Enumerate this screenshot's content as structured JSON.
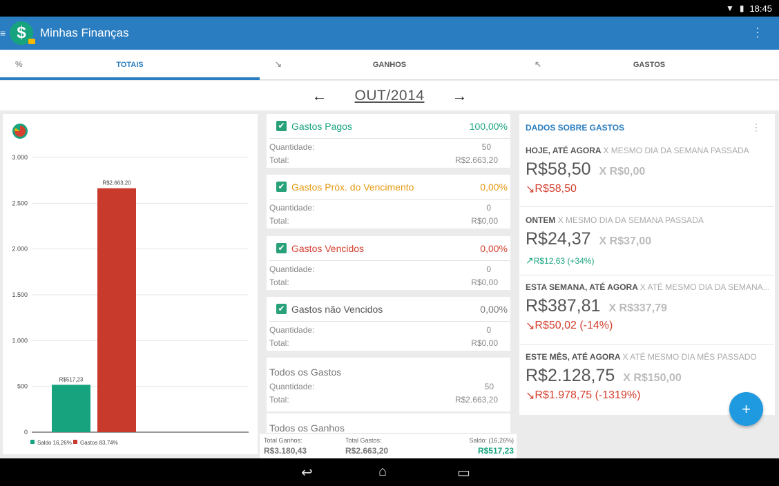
{
  "status": {
    "time": "18:45",
    "wifi_icon": "wifi-icon",
    "battery_icon": "battery-icon"
  },
  "app": {
    "title": "Minhas Finanças",
    "logo_icon": "dollar-icon"
  },
  "tabs": [
    {
      "label": "TOTAIS",
      "icon": "percent-icon",
      "active": true
    },
    {
      "label": "GANHOS",
      "icon": "income-arrow-icon",
      "active": false
    },
    {
      "label": "GASTOS",
      "icon": "expense-arrow-icon",
      "active": false
    }
  ],
  "month": {
    "label": "OUT/2014",
    "prev": "←",
    "next": "→"
  },
  "chart_data": {
    "type": "bar",
    "categories": [
      "Saldo",
      "Gastos"
    ],
    "values": [
      517.23,
      2663.2
    ],
    "data_labels": [
      "R$517,23",
      "R$2.663,20"
    ],
    "colors": [
      "#18a37f",
      "#c73a2c"
    ],
    "ylim": [
      0,
      3000
    ],
    "yticks": [
      0,
      500,
      1000,
      1500,
      2000,
      2500,
      3000
    ],
    "ytick_labels": [
      "0",
      "500",
      "1.000",
      "1.500",
      "2.000",
      "2.500",
      "3.000"
    ],
    "legend": [
      "Saldo 16,26%",
      "Gastos 83,74%"
    ],
    "legend_position": "bottom-left",
    "grid": true
  },
  "cards": [
    {
      "name": "Gastos Pagos",
      "pct": "100,00%",
      "color": "#18a37f",
      "qty_label": "Quantidade:",
      "qty": "50",
      "total_label": "Total:",
      "total": "R$2.663,20",
      "checked": true
    },
    {
      "name": "Gastos Próx. do Vencimento",
      "pct": "0,00%",
      "color": "#e39a12",
      "qty_label": "Quantidade:",
      "qty": "0",
      "total_label": "Total:",
      "total": "R$0,00",
      "checked": true
    },
    {
      "name": "Gastos Vencidos",
      "pct": "0,00%",
      "color": "#d5402f",
      "qty_label": "Quantidade:",
      "qty": "0",
      "total_label": "Total:",
      "total": "R$0,00",
      "checked": true
    },
    {
      "name": "Gastos não Vencidos",
      "pct": "0,00%",
      "color": "#555555",
      "qty_label": "Quantidade:",
      "qty": "0",
      "total_label": "Total:",
      "total": "R$0,00",
      "checked": true
    },
    {
      "name": "Todos os Gastos",
      "pct": "",
      "color": "#777777",
      "qty_label": "Quantidade:",
      "qty": "50",
      "total_label": "Total:",
      "total": "R$2.663,20",
      "checked": false
    },
    {
      "name": "Todos os Ganhos",
      "pct": "",
      "color": "#777777",
      "qty_label": "",
      "qty": "",
      "total_label": "",
      "total": "",
      "checked": false
    }
  ],
  "totals_bar": {
    "ganhos_label": "Total Ganhos:",
    "ganhos": "R$3.180,43",
    "gastos_label": "Total Gastos:",
    "gastos": "R$2.663,20",
    "saldo_label": "Saldo:  (16,26%)",
    "saldo": "R$517,23"
  },
  "stats": {
    "title": "DADOS SOBRE GASTOS",
    "sections": [
      {
        "label": "HOJE, ATÉ AGORA",
        "compare": "X MESMO DIA DA SEMANA PASSADA",
        "value": "R$58,50",
        "prev": "X R$0,00",
        "delta": "R$58,50",
        "trend": "down"
      },
      {
        "label": "ONTEM",
        "compare": "X MESMO DIA DA SEMANA PASSADA",
        "value": "R$24,37",
        "prev": "X R$37,00",
        "delta": "R$12,63 (+34%)",
        "trend": "up"
      },
      {
        "label": "ESTA SEMANA, ATÉ AGORA",
        "compare": "X ATÉ MESMO DIA DA SEMANA...",
        "value": "R$387,81",
        "prev": "X R$337,79",
        "delta": "R$50,02 (-14%)",
        "trend": "down"
      },
      {
        "label": "ESTE MÊS, ATÉ AGORA",
        "compare": "X ATÉ MESMO DIA MÊS PASSADO",
        "value": "R$2.128,75",
        "prev": "X R$150,00",
        "delta": "R$1.978,75 (-1319%)",
        "trend": "down"
      }
    ]
  },
  "fab": {
    "label": "+"
  },
  "navbar": {
    "back_icon": "back-icon",
    "home_icon": "home-icon",
    "recents_icon": "recents-icon"
  }
}
